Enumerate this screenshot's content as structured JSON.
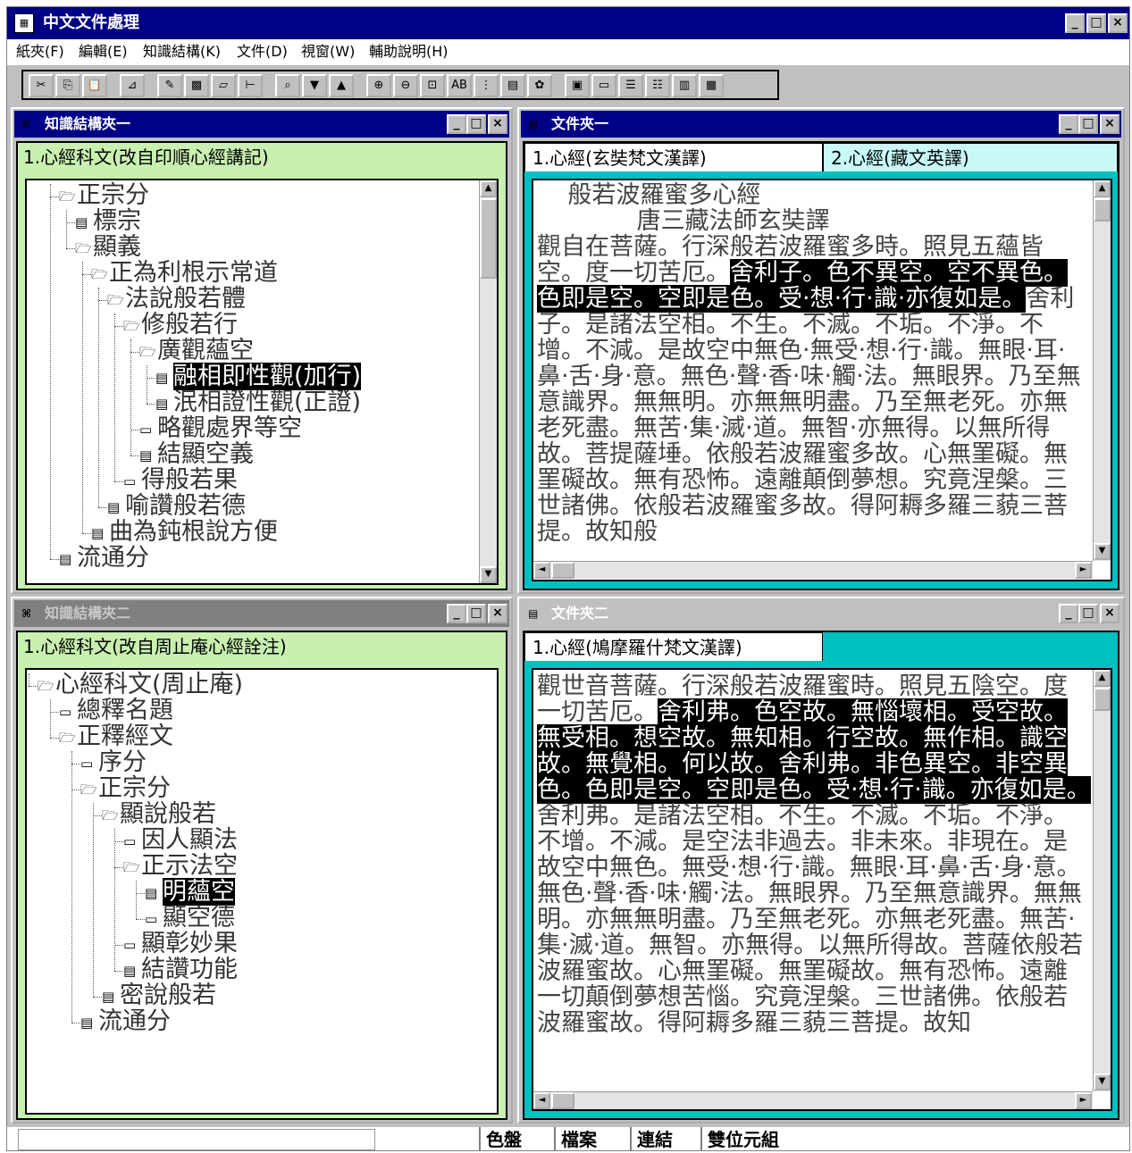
{
  "window": {
    "title": "中文文件處理",
    "minimize": "_",
    "maximize": "□",
    "close": "×"
  },
  "menu": [
    "紙夾(F)",
    "編輯(E)",
    "知識結構(K)",
    "文件(D)",
    "視窗(W)",
    "輔助說明(H)"
  ],
  "toolbar": [
    {
      "icon": "cut-icon",
      "glyph": "✂"
    },
    {
      "icon": "copy-icon",
      "glyph": "⎘"
    },
    {
      "icon": "paste-icon",
      "glyph": "📋"
    },
    {
      "icon": "chart-icon",
      "glyph": "⊿"
    },
    {
      "icon": "pen-icon",
      "glyph": "✎"
    },
    {
      "icon": "pattern-icon",
      "glyph": "▩"
    },
    {
      "icon": "box-icon",
      "glyph": "▱"
    },
    {
      "icon": "insert-icon",
      "glyph": "⊢"
    },
    {
      "icon": "find-icon",
      "glyph": "⌕"
    },
    {
      "icon": "down-icon",
      "glyph": "▼"
    },
    {
      "icon": "up-icon",
      "glyph": "▲"
    },
    {
      "icon": "zoom-in-icon",
      "glyph": "⊕"
    },
    {
      "icon": "zoom-out-icon",
      "glyph": "⊖"
    },
    {
      "icon": "preview-icon",
      "glyph": "⊡"
    },
    {
      "icon": "text-style-icon",
      "glyph": "AB"
    },
    {
      "icon": "tree-icon",
      "glyph": "⋮"
    },
    {
      "icon": "doc-view-icon",
      "glyph": "▤"
    },
    {
      "icon": "palette-icon",
      "glyph": "✿"
    },
    {
      "icon": "window1-icon",
      "glyph": "▣"
    },
    {
      "icon": "folder-icon",
      "glyph": "▭"
    },
    {
      "icon": "list1-icon",
      "glyph": "☰"
    },
    {
      "icon": "list2-icon",
      "glyph": "☷"
    },
    {
      "icon": "doc1-icon",
      "glyph": "▥"
    },
    {
      "icon": "doc2-icon",
      "glyph": "▦"
    }
  ],
  "kpanel1": {
    "title": "知識結構夾一",
    "tab": "1.心經科文(改自印順心經講記)",
    "nodes": [
      {
        "label": "正宗分",
        "type": "folder-open",
        "level": 0
      },
      {
        "label": "標宗",
        "type": "doc",
        "level": 1
      },
      {
        "label": "顯義",
        "type": "folder-open",
        "level": 1
      },
      {
        "label": "正為利根示常道",
        "type": "folder-open",
        "level": 2
      },
      {
        "label": "法說般若體",
        "type": "folder-open",
        "level": 3
      },
      {
        "label": "修般若行",
        "type": "folder-open",
        "level": 4
      },
      {
        "label": "廣觀蘊空",
        "type": "folder-open",
        "level": 5
      },
      {
        "label": "融相即性觀(加行)",
        "type": "doc",
        "level": 6,
        "selected": true
      },
      {
        "label": "泯相證性觀(正證)",
        "type": "doc",
        "level": 6
      },
      {
        "label": "略觀處界等空",
        "type": "folder",
        "level": 5
      },
      {
        "label": "結顯空義",
        "type": "doc",
        "level": 5
      },
      {
        "label": "得般若果",
        "type": "folder",
        "level": 4
      },
      {
        "label": "喻讚般若德",
        "type": "doc",
        "level": 3
      },
      {
        "label": "曲為鈍根說方便",
        "type": "doc",
        "level": 2
      },
      {
        "label": "流通分",
        "type": "doc",
        "level": 0
      }
    ]
  },
  "kpanel2": {
    "title": "知識結構夾二",
    "tab": "1.心經科文(改自周止庵心經詮注)",
    "nodes": [
      {
        "label": "心經科文(周止庵)",
        "type": "folder-open",
        "level": 0
      },
      {
        "label": "總釋名題",
        "type": "folder",
        "level": 1
      },
      {
        "label": "正釋經文",
        "type": "folder-open",
        "level": 1
      },
      {
        "label": "序分",
        "type": "folder",
        "level": 2
      },
      {
        "label": "正宗分",
        "type": "folder-open",
        "level": 2
      },
      {
        "label": "顯說般若",
        "type": "folder-open",
        "level": 3
      },
      {
        "label": "因人顯法",
        "type": "folder",
        "level": 4
      },
      {
        "label": "正示法空",
        "type": "folder-open",
        "level": 4
      },
      {
        "label": "明蘊空",
        "type": "doc",
        "level": 5,
        "selected": true
      },
      {
        "label": "顯空德",
        "type": "folder",
        "level": 5
      },
      {
        "label": "顯彰妙果",
        "type": "folder",
        "level": 4
      },
      {
        "label": "結讚功能",
        "type": "doc",
        "level": 4
      },
      {
        "label": "密說般若",
        "type": "doc",
        "level": 3
      },
      {
        "label": "流通分",
        "type": "doc",
        "level": 2
      }
    ]
  },
  "dpanel1": {
    "title": "文件夾一",
    "tabs": [
      "1.心經(玄奘梵文漢譯)",
      "2.心經(藏文英譯)"
    ],
    "before": "    般若波羅蜜多心經\n             唐三藏法師玄奘譯\n觀自在菩薩。行深般若波羅蜜多時。照見五蘊皆空。度一切苦厄。",
    "highlight": "舍利子。色不異空。空不異色。色即是空。空即是色。受‧想‧行‧識‧亦復如是。",
    "after": "舍利子。是諸法空相。不生。不滅。不垢。不淨。不增。不減。是故空中無色‧無受‧想‧行‧識。無眼‧耳‧鼻‧舌‧身‧意。無色‧聲‧香‧味‧觸‧法。無眼界。乃至無意識界。無無明。亦無無明盡。乃至無老死。亦無老死盡。無苦‧集‧滅‧道。無智‧亦無得。以無所得故。菩提薩埵。依般若波羅蜜多故。心無罣礙。無罣礙故。無有恐怖。遠離顛倒夢想。究竟涅槃。三世諸佛。依般若波羅蜜多故。得阿耨多羅三藐三菩提。故知般"
  },
  "dpanel2": {
    "title": "文件夾二",
    "tabs": [
      "1.心經(鳩摩羅什梵文漢譯)"
    ],
    "before": "觀世音菩薩。行深般若波羅蜜時。照見五陰空。度一切苦厄。",
    "highlight": "舍利弗。色空故。無惱壞相。受空故。無受相。想空故。無知相。行空故。無作相。識空故。無覺相。何以故。舍利弗。非色異空。非空異色。色即是空。空即是色。受‧想‧行‧識。亦復如是。",
    "after": "舍利弗。是諸法空相。不生。不滅。不垢。不淨。不增。不減。是空法非過去。非未來。非現在。是故空中無色。無受‧想‧行‧識。無眼‧耳‧鼻‧舌‧身‧意。無色‧聲‧香‧味‧觸‧法。無眼界。乃至無意識界。無無明。亦無無明盡。乃至無老死。亦無老死盡。無苦‧集‧滅‧道。無智。亦無得。以無所得故。菩薩依般若波羅蜜故。心無罣礙。無罣礙故。無有恐怖。遠離一切顛倒夢想苦惱。究竟涅槃。三世諸佛。依般若波羅蜜故。得阿耨多羅三藐三菩提。故知"
  },
  "status": [
    "色盤",
    "檔案",
    "連結",
    "雙位元組"
  ]
}
